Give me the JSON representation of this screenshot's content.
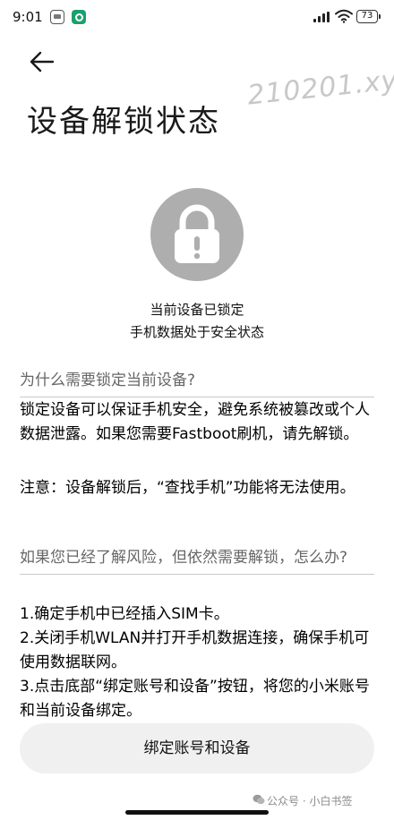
{
  "status_bar": {
    "time": "9:01",
    "battery": "73"
  },
  "header": {
    "title": "设备解锁状态",
    "watermark": "210201.xyz"
  },
  "lock_status": {
    "line1": "当前设备已锁定",
    "line2": "手机数据处于安全状态"
  },
  "why_section": {
    "heading": "为什么需要锁定当前设备?",
    "paragraph": "锁定设备可以保证手机安全，避免系统被篡改或个人数据泄露。如果您需要Fastboot刷机，请先解锁。",
    "note": "注意：设备解锁后，“查找手机”功能将无法使用。"
  },
  "how_section": {
    "heading": "如果您已经了解风险，但依然需要解锁，怎么办?",
    "steps": [
      "1.确定手机中已经插入SIM卡。",
      "2.关闭手机WLAN并打开手机数据连接，确保手机可使用数据联网。",
      "3.点击底部“绑定账号和设备”按钮，将您的小米账号和当前设备绑定。"
    ]
  },
  "bind_button_label": "绑定账号和设备",
  "credit": "公众号 · 小白书签",
  "icons": {
    "back": "arrow-left-icon",
    "lock": "padlock-icon",
    "signal": "signal-icon",
    "wifi": "wifi-icon",
    "battery": "battery-icon"
  },
  "colors": {
    "lock_circle": "#aeaeae",
    "button_bg": "#f0f0f0",
    "heading_text": "#666666"
  }
}
